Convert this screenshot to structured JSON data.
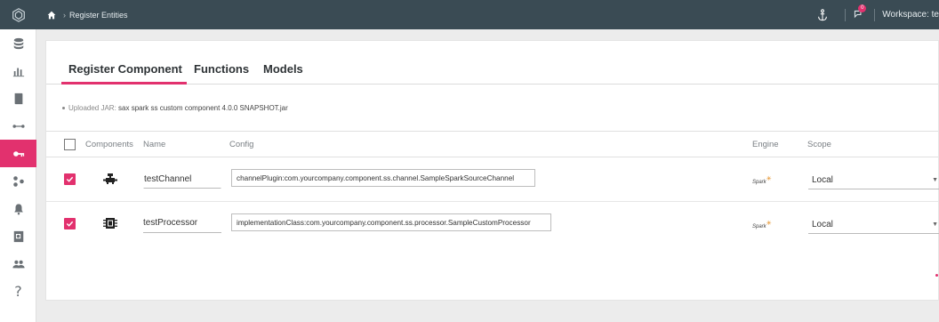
{
  "header": {
    "breadcrumb": "Register Entities",
    "notification_count": "0",
    "workspace_label": "Workspace: te"
  },
  "sidebar": {
    "items": [
      {
        "icon": "database-icon"
      },
      {
        "icon": "bar-chart-icon"
      },
      {
        "icon": "book-icon"
      },
      {
        "icon": "connector-icon"
      },
      {
        "icon": "key-icon",
        "active": true
      },
      {
        "icon": "cluster-icon"
      },
      {
        "icon": "bell-icon"
      },
      {
        "icon": "search-doc-icon"
      },
      {
        "icon": "users-icon"
      },
      {
        "icon": "help-icon",
        "glyph": "?"
      }
    ]
  },
  "tabs": [
    {
      "label": "Register Component",
      "active": true
    },
    {
      "label": "Functions"
    },
    {
      "label": "Models"
    }
  ],
  "upload": {
    "label": "Uploaded JAR:",
    "filename": "sax spark ss custom component 4.0.0 SNAPSHOT.jar"
  },
  "table": {
    "columns": {
      "components": "Components",
      "name": "Name",
      "config": "Config",
      "engine": "Engine",
      "scope": "Scope"
    },
    "rows": [
      {
        "checked": true,
        "icon": "channel-icon",
        "name": "testChannel",
        "config": "channelPlugin:com.yourcompany.component.ss.channel.SampleSparkSourceChannel",
        "engine": "Spark",
        "scope": "Local"
      },
      {
        "checked": true,
        "icon": "processor-icon",
        "name": "testProcessor",
        "config": "implementationClass:com.yourcompany.component.ss.processor.SampleCustomProcessor",
        "engine": "Spark",
        "scope": "Local"
      }
    ]
  },
  "colors": {
    "accent": "#e2316e",
    "header_bg": "#3a4b54"
  }
}
